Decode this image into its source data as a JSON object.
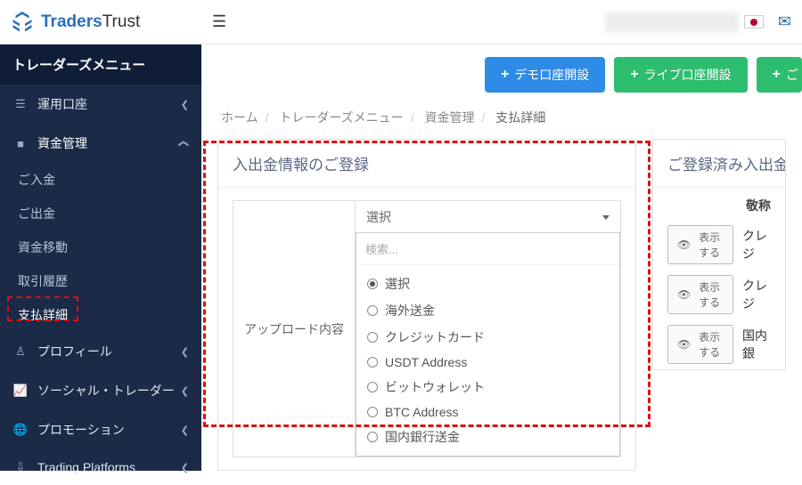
{
  "logo": {
    "bold": "Traders",
    "light": "Trust"
  },
  "menu_title": "トレーダーズメニュー",
  "sidebar": {
    "items": [
      {
        "label": "運用口座",
        "icon": "list-icon",
        "has_children": true
      },
      {
        "label": "資金管理",
        "icon": "wallet-icon",
        "has_children": true,
        "open": true
      },
      {
        "label": "プロフィール",
        "icon": "user-icon",
        "has_children": true
      },
      {
        "label": "ソーシャル・トレーダー",
        "icon": "chart-icon",
        "has_children": true
      },
      {
        "label": "プロモーション",
        "icon": "globe-icon",
        "has_children": true
      },
      {
        "label": "Trading Platforms",
        "icon": "download-icon",
        "has_children": true
      }
    ],
    "submenu": [
      {
        "label": "ご入金"
      },
      {
        "label": "ご出金"
      },
      {
        "label": "資金移動"
      },
      {
        "label": "取引履歴"
      },
      {
        "label": "支払詳細",
        "active": true
      }
    ]
  },
  "topbar": {
    "flag": "jp",
    "mail_icon": "mail-icon"
  },
  "buttons": {
    "demo": "デモ口座開設",
    "live": "ライブ口座開設",
    "deposit_partial": "ご"
  },
  "breadcrumb": {
    "items": [
      "ホーム",
      "トレーダーズメニュー",
      "資金管理",
      "支払詳細"
    ]
  },
  "left_panel": {
    "title": "入出金情報のご登録",
    "field_label": "アップロード内容",
    "selected": "選択",
    "search_placeholder": "検索...",
    "options": [
      {
        "label": "選択",
        "checked": true
      },
      {
        "label": "海外送金",
        "checked": false
      },
      {
        "label": "クレジットカード",
        "checked": false
      },
      {
        "label": "USDT Address",
        "checked": false
      },
      {
        "label": "ビットウォレット",
        "checked": false
      },
      {
        "label": "BTC Address",
        "checked": false
      },
      {
        "label": "国内銀行送金",
        "checked": false
      }
    ]
  },
  "right_panel": {
    "title": "ご登録済み入出金",
    "col_header": "敬称",
    "show_label": "表示する",
    "rows": [
      {
        "text": "クレジ"
      },
      {
        "text": "クレジ"
      },
      {
        "text": "国内銀"
      }
    ]
  }
}
